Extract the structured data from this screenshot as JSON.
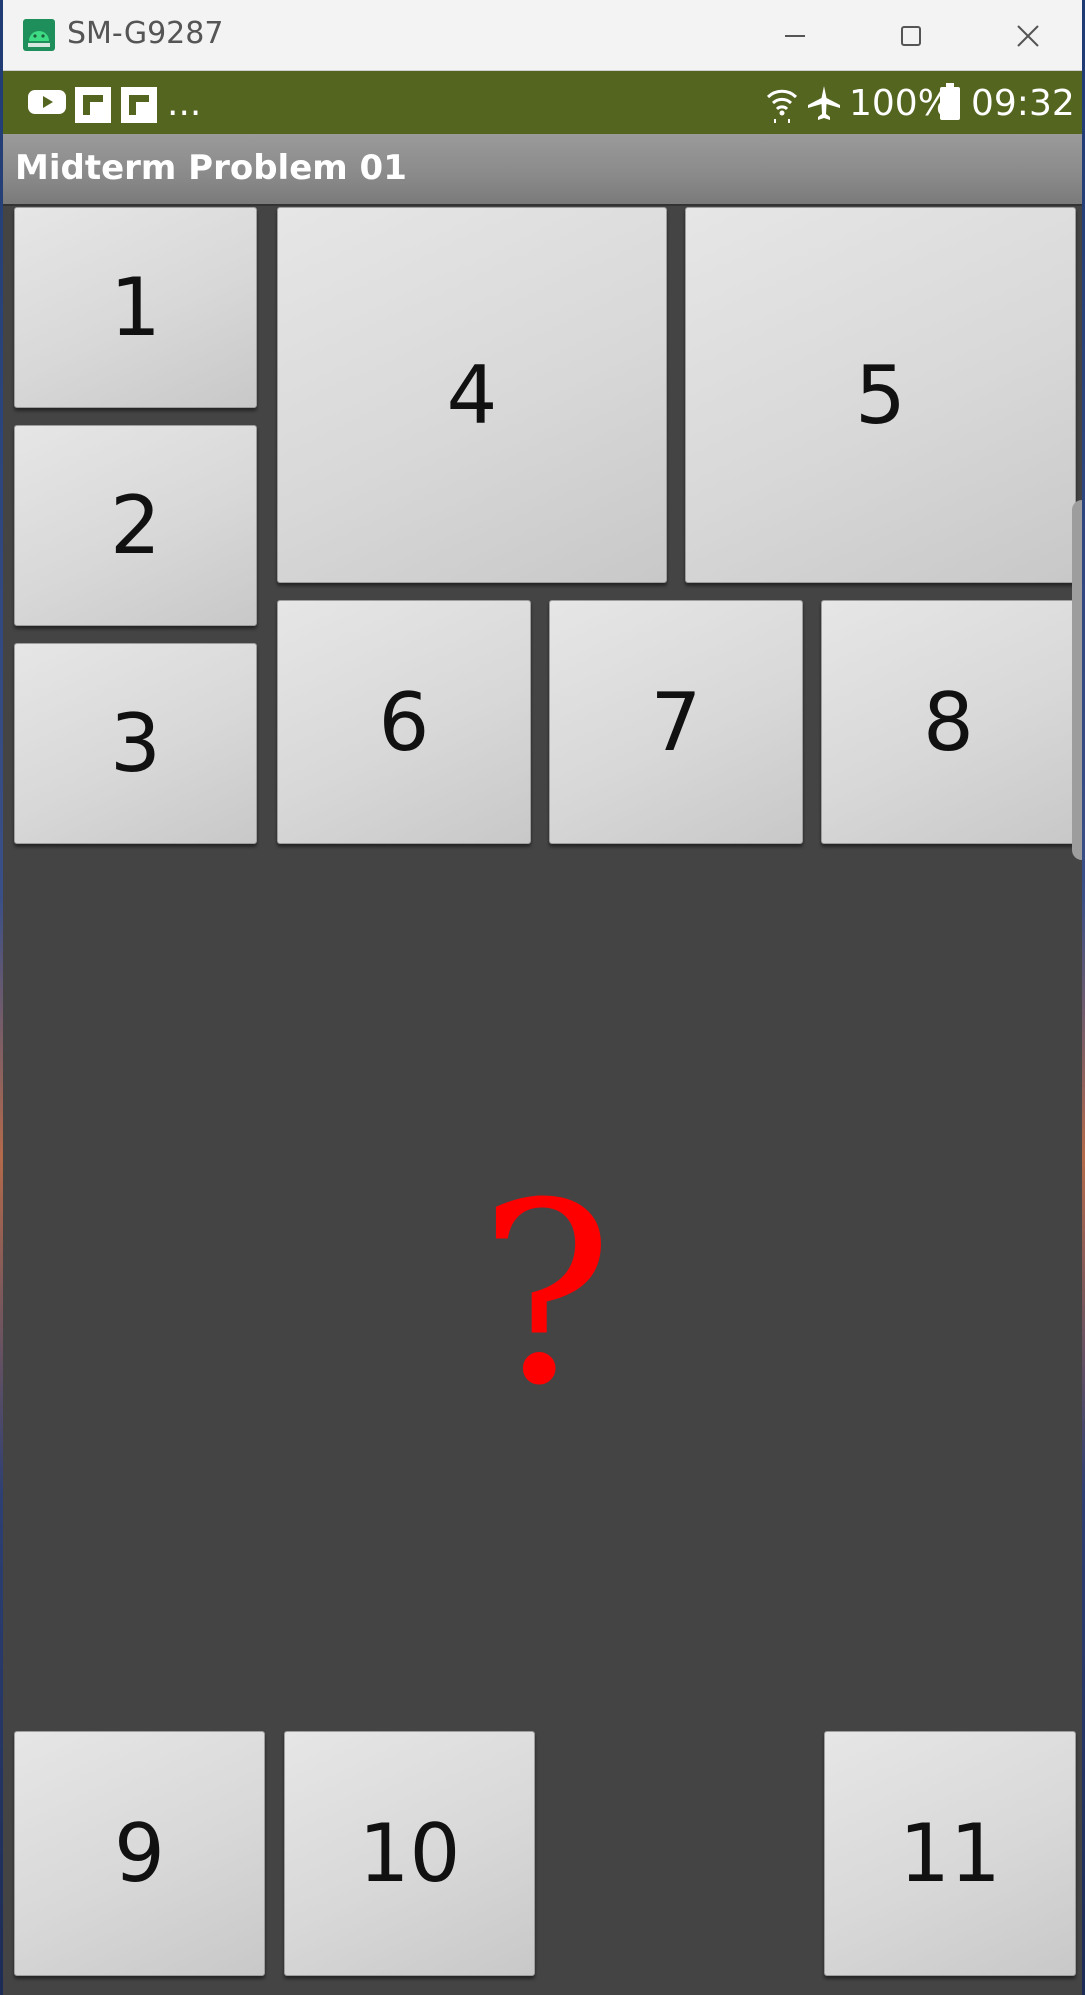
{
  "window": {
    "title": "SM-G9287",
    "controls": [
      "minimize-icon",
      "maximize-icon",
      "close-icon"
    ]
  },
  "status_bar": {
    "notification_icons": [
      "youtube-icon",
      "flipboard-icon",
      "flipboard-icon"
    ],
    "overflow": "...",
    "battery": "100%",
    "time": "09:32",
    "system_icons": [
      "wifi-icon",
      "airplane-mode-icon",
      "battery-icon"
    ]
  },
  "action_bar": {
    "title": "Midterm Problem 01"
  },
  "tiles": [
    "1",
    "2",
    "3",
    "4",
    "5",
    "6",
    "7",
    "8",
    "9",
    "10",
    "11"
  ],
  "center_text": "?",
  "colors": {
    "status_bar": "#546520",
    "background": "#444444",
    "question_mark": "#ff0000"
  }
}
